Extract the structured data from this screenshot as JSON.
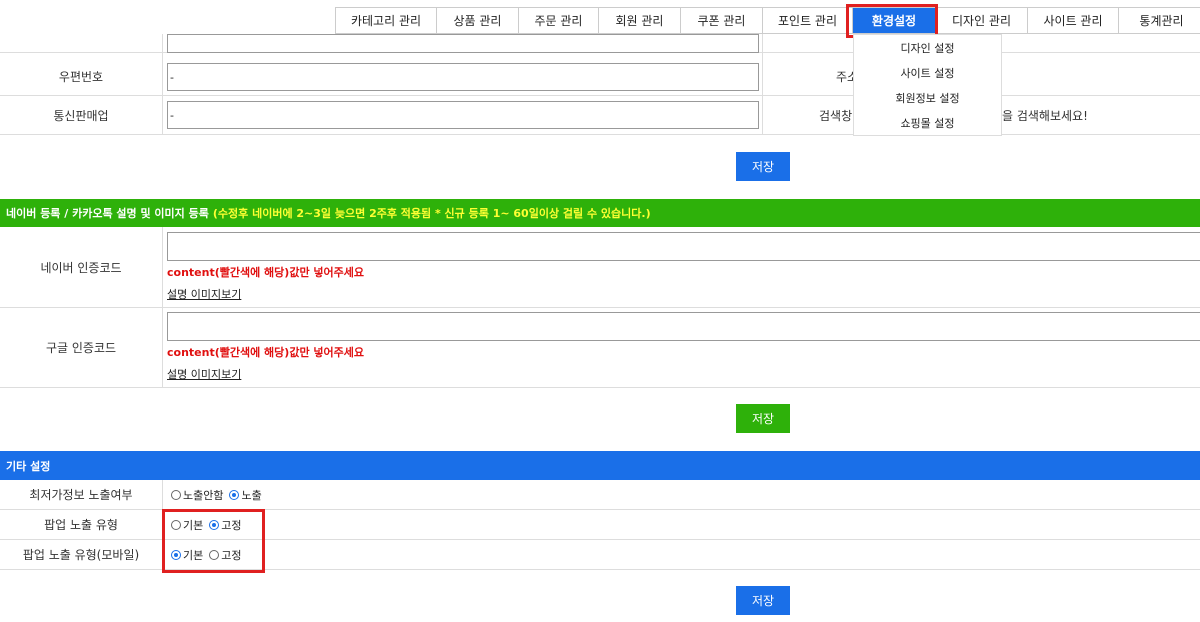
{
  "nav": {
    "items": [
      "카테고리 관리",
      "상품 관리",
      "주문 관리",
      "회원 관리",
      "쿠폰 관리",
      "포인트 관리",
      "환경설정",
      "디자인 관리",
      "사이트 관리",
      "통계관리"
    ],
    "active": "환경설정",
    "dropdown": [
      "디자인 설정",
      "사이트 설정",
      "회원정보 설정",
      "쇼핑몰 설정"
    ]
  },
  "form_top": {
    "postcode_label": "우편번호",
    "postcode_value": "-",
    "address_label": "주소",
    "ecommerce_label": "통신판매업",
    "ecommerce_value": "-",
    "search_label": "검색창",
    "search_hint": "을 검색해보세요!",
    "save": "저장"
  },
  "verification": {
    "header": "네이버 등록 / 카카오톡 설명 및 이미지 등록",
    "header_note": "(수정후 네이버에 2~3일 늦으면 2주후 적용됨 * 신규 등록 1~ 60일이상 걸릴 수 있습니다.)",
    "naver_label": "네이버 인증코드",
    "naver_hint": "content(빨간색에 해당)값만 넣어주세요",
    "naver_link": "설명 이미지보기",
    "google_label": "구글 인증코드",
    "google_hint": "content(빨간색에 해당)값만 넣어주세요",
    "google_link": "설명 이미지보기",
    "save": "저장"
  },
  "etc": {
    "header": "기타 설정",
    "lowest_price_label": "최저가정보 노출여부",
    "lowest_price_options": [
      "노출안함",
      "노출"
    ],
    "lowest_price_selected": "노출",
    "popup_label": "팝업 노출 유형",
    "popup_options": [
      "기본",
      "고정"
    ],
    "popup_selected": "고정",
    "popup_mobile_label": "팝업 노출 유형(모바일)",
    "popup_mobile_options": [
      "기본",
      "고정"
    ],
    "popup_mobile_selected": "기본",
    "save": "저장"
  },
  "colors": {
    "accent_blue": "#1a6fe8",
    "accent_green": "#2eb10a",
    "highlight_red": "#e02020",
    "hint_red": "#e01010",
    "note_yellow": "#ffff33"
  }
}
